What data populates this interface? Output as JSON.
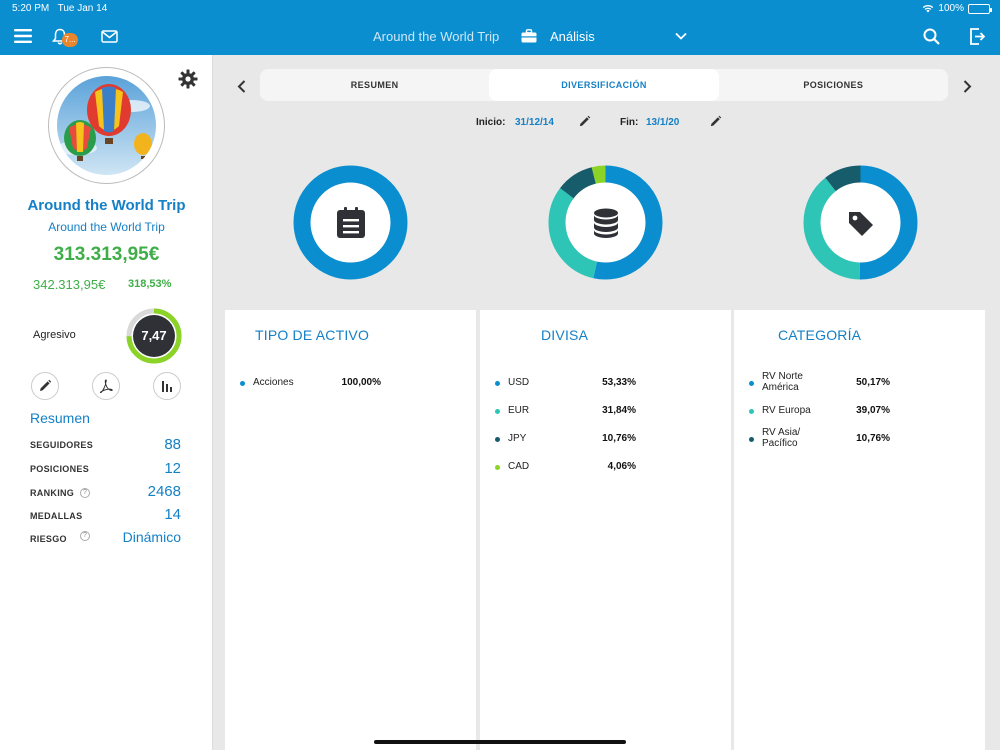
{
  "status_bar": {
    "time": "5:20 PM",
    "date": "Tue Jan 14",
    "battery": "100%"
  },
  "navbar": {
    "badge": "7...",
    "portfolio_title": "Around the World Trip",
    "section_title": "Análisis"
  },
  "sidebar": {
    "portfolio_name": "Around the World Trip",
    "portfolio_subtitle": "Around the World Trip",
    "current_value": "313.313,95€",
    "invested_value": "342.313,95€",
    "return_pct": "318,53%",
    "risk_profile": "Agresivo",
    "risk_score": "7,47",
    "risk_score_fraction": 0.747,
    "summary_title": "Resumen",
    "stats": [
      {
        "label": "SEGUIDORES",
        "value": "88"
      },
      {
        "label": "POSICIONES",
        "value": "12"
      },
      {
        "label": "RANKING",
        "value": "2468"
      },
      {
        "label": "MEDALLAS",
        "value": "14"
      },
      {
        "label": "RIESGO",
        "value": "Dinámico"
      }
    ],
    "help_glyph": "?"
  },
  "tabs": [
    {
      "label": "RESUMEN"
    },
    {
      "label": "DIVERSIFICACIÓN"
    },
    {
      "label": "POSICIONES"
    }
  ],
  "dates": {
    "start_label": "Inicio:",
    "start_value": "31/12/14",
    "end_label": "Fin:",
    "end_value": "13/1/20"
  },
  "colors": {
    "blue": "#0a8ed0",
    "teal": "#2ec4b6",
    "dark_teal": "#165c6b",
    "green": "#8cd327",
    "accent_green": "#3fae49"
  },
  "chart_data": [
    {
      "type": "pie",
      "title": "TIPO DE ACTIVO",
      "icon": "document-icon",
      "categories": [
        "Acciones"
      ],
      "values": [
        100.0
      ],
      "labels": [
        "100,00%"
      ],
      "colors": [
        "#0a8ed0"
      ]
    },
    {
      "type": "pie",
      "title": "DIVISA",
      "icon": "database-icon",
      "categories": [
        "USD",
        "EUR",
        "JPY",
        "CAD"
      ],
      "values": [
        53.33,
        31.84,
        10.76,
        4.06
      ],
      "labels": [
        "53,33%",
        "31,84%",
        "10,76%",
        "4,06%"
      ],
      "colors": [
        "#0a8ed0",
        "#2ec4b6",
        "#165c6b",
        "#8cd327"
      ]
    },
    {
      "type": "pie",
      "title": "CATEGORÍA",
      "icon": "tag-icon",
      "categories": [
        "RV Norte América",
        "RV Europa",
        "RV Asia/ Pacífico"
      ],
      "values": [
        50.17,
        39.07,
        10.76
      ],
      "labels": [
        "50,17%",
        "39,07%",
        "10,76%"
      ],
      "colors": [
        "#0a8ed0",
        "#2ec4b6",
        "#165c6b"
      ]
    }
  ]
}
